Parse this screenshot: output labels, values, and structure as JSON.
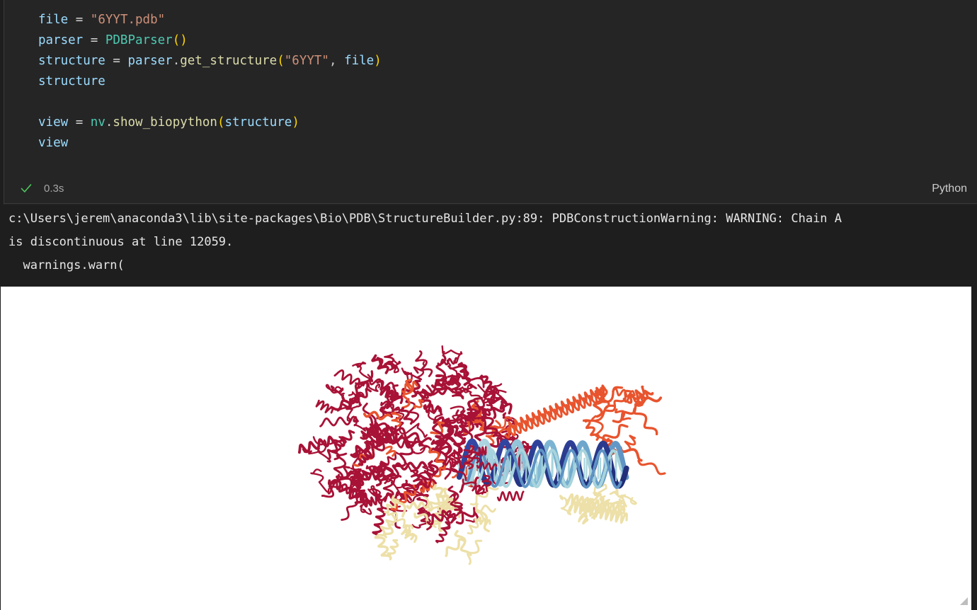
{
  "cell": {
    "language": "Python",
    "execution_time": "0.3s",
    "status_icon": "check-icon",
    "code_lines": [
      {
        "tokens": [
          {
            "t": "file",
            "c": "var"
          },
          {
            "t": " ",
            "c": "op"
          },
          {
            "t": "=",
            "c": "op"
          },
          {
            "t": " ",
            "c": "op"
          },
          {
            "t": "\"6YYT.pdb\"",
            "c": "str"
          }
        ]
      },
      {
        "tokens": [
          {
            "t": "parser",
            "c": "var"
          },
          {
            "t": " ",
            "c": "op"
          },
          {
            "t": "=",
            "c": "op"
          },
          {
            "t": " ",
            "c": "op"
          },
          {
            "t": "PDBParser",
            "c": "class"
          },
          {
            "t": "()",
            "c": "paren"
          }
        ]
      },
      {
        "tokens": [
          {
            "t": "structure",
            "c": "var"
          },
          {
            "t": " ",
            "c": "op"
          },
          {
            "t": "=",
            "c": "op"
          },
          {
            "t": " ",
            "c": "op"
          },
          {
            "t": "parser",
            "c": "var"
          },
          {
            "t": ".",
            "c": "punct"
          },
          {
            "t": "get_structure",
            "c": "fn"
          },
          {
            "t": "(",
            "c": "paren"
          },
          {
            "t": "\"6YYT\"",
            "c": "str"
          },
          {
            "t": ",",
            "c": "punct"
          },
          {
            "t": " ",
            "c": "op"
          },
          {
            "t": "file",
            "c": "var"
          },
          {
            "t": ")",
            "c": "paren"
          }
        ]
      },
      {
        "tokens": [
          {
            "t": "structure",
            "c": "var"
          }
        ]
      },
      {
        "tokens": []
      },
      {
        "tokens": [
          {
            "t": "view",
            "c": "var"
          },
          {
            "t": " ",
            "c": "op"
          },
          {
            "t": "=",
            "c": "op"
          },
          {
            "t": " ",
            "c": "op"
          },
          {
            "t": "nv",
            "c": "class"
          },
          {
            "t": ".",
            "c": "punct"
          },
          {
            "t": "show_biopython",
            "c": "fn"
          },
          {
            "t": "(",
            "c": "paren"
          },
          {
            "t": "structure",
            "c": "var"
          },
          {
            "t": ")",
            "c": "paren"
          }
        ]
      },
      {
        "tokens": [
          {
            "t": "view",
            "c": "var"
          }
        ]
      }
    ]
  },
  "output": {
    "stream": "stderr",
    "lines": [
      "c:\\Users\\jerem\\anaconda3\\lib\\site-packages\\Bio\\PDB\\StructureBuilder.py:89: PDBConstructionWarning: WARNING: Chain A",
      "is discontinuous at line 12059.",
      "  warnings.warn("
    ]
  },
  "viewer": {
    "name": "nglview-molecular-viewer",
    "background": "#FFFFFF",
    "structure_id": "6YYT",
    "representation": "cartoon",
    "resize_handle": "resize-handle-icon",
    "palette": {
      "protein_crimson": "#A81236",
      "protein_orange": "#E8542E",
      "protein_pale_yellow": "#EDE0A8",
      "nucleic_navy": "#2B3A8F",
      "nucleic_steel": "#5E93C4",
      "nucleic_light_cyan": "#A8D4DC"
    }
  },
  "colors": {
    "editor_bg": "#252526",
    "output_bg": "#1E1E1E",
    "code_text": "#D4D4D4",
    "variable": "#9CDCFE",
    "string": "#CE9178",
    "class_name": "#4EC9B0",
    "function": "#DCDCAA",
    "bracket": "#FFD700",
    "success_green": "#4EC95A",
    "muted_text": "#A6A6A6"
  }
}
